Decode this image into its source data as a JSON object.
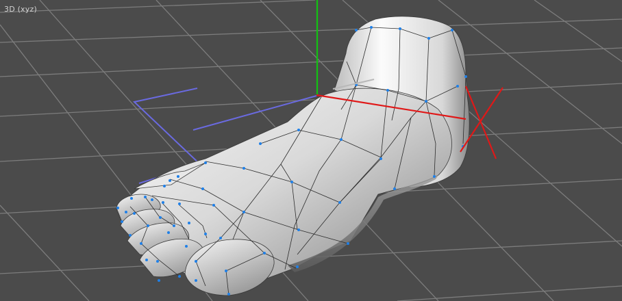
{
  "viewport": {
    "label": "3D (xyz)",
    "background": "#4b4b4b"
  },
  "colors": {
    "grid_line": "#7c7c7c",
    "axis_x": "#e01818",
    "axis_y": "#10c010",
    "axis_z_guide": "#6c6ce0",
    "mesh_wire": "#2a2a2a",
    "mesh_vertex": "#1e7fe6",
    "mesh_surface_light": "#f4f4f4",
    "mesh_surface_dark": "#7a7a7a"
  },
  "icons": [
    "foot-mesh-model",
    "transform-gizmo"
  ]
}
